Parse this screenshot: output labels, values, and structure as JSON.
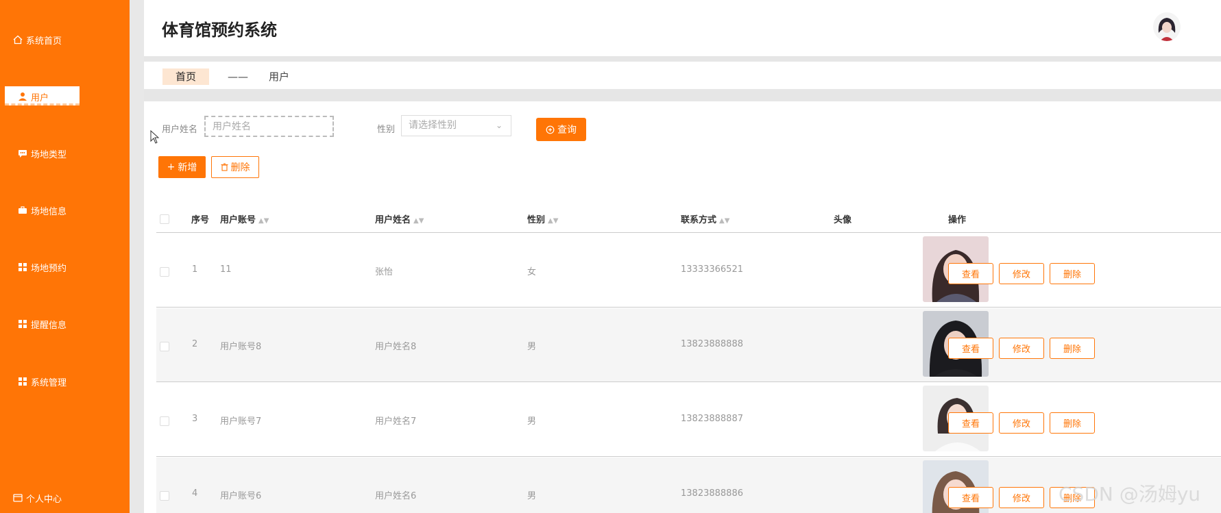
{
  "app": {
    "title": "体育馆预约系统"
  },
  "sidebar": {
    "items": [
      {
        "label": "系统首页",
        "icon": "home-icon"
      },
      {
        "label": "用户",
        "icon": "user-icon",
        "active": true
      },
      {
        "label": "场地类型",
        "icon": "chat-icon"
      },
      {
        "label": "场地信息",
        "icon": "briefcase-icon"
      },
      {
        "label": "场地预约",
        "icon": "grid-icon"
      },
      {
        "label": "提醒信息",
        "icon": "grid-icon"
      },
      {
        "label": "系统管理",
        "icon": "grid-icon"
      },
      {
        "label": "个人中心",
        "icon": "id-card-icon"
      }
    ]
  },
  "breadcrumb": {
    "home": "首页",
    "separator": "——",
    "current": "用户"
  },
  "search": {
    "name_label": "用户姓名",
    "name_placeholder": "用户姓名",
    "sex_label": "性别",
    "sex_placeholder": "请选择性别",
    "query_label": "查询"
  },
  "toolbar": {
    "add_label": "新增",
    "delete_label": "删除"
  },
  "table": {
    "columns": [
      "序号",
      "用户账号",
      "用户姓名",
      "性别",
      "联系方式",
      "头像",
      "操作"
    ],
    "rows": [
      {
        "index": "1",
        "account": "11",
        "name": "张怡",
        "sex": "女",
        "phone": "13333366521"
      },
      {
        "index": "2",
        "account": "用户账号8",
        "name": "用户姓名8",
        "sex": "男",
        "phone": "13823888888"
      },
      {
        "index": "3",
        "account": "用户账号7",
        "name": "用户姓名7",
        "sex": "男",
        "phone": "13823888887"
      },
      {
        "index": "4",
        "account": "用户账号6",
        "name": "用户姓名6",
        "sex": "男",
        "phone": "13823888886"
      }
    ],
    "actions": {
      "view": "查看",
      "edit": "修改",
      "delete": "删除"
    }
  },
  "watermark": "CSDN @汤姆yu",
  "colors": {
    "accent": "#ff7506",
    "page_gap": "#e6e6e6",
    "row_alt": "#f5f5f5"
  }
}
